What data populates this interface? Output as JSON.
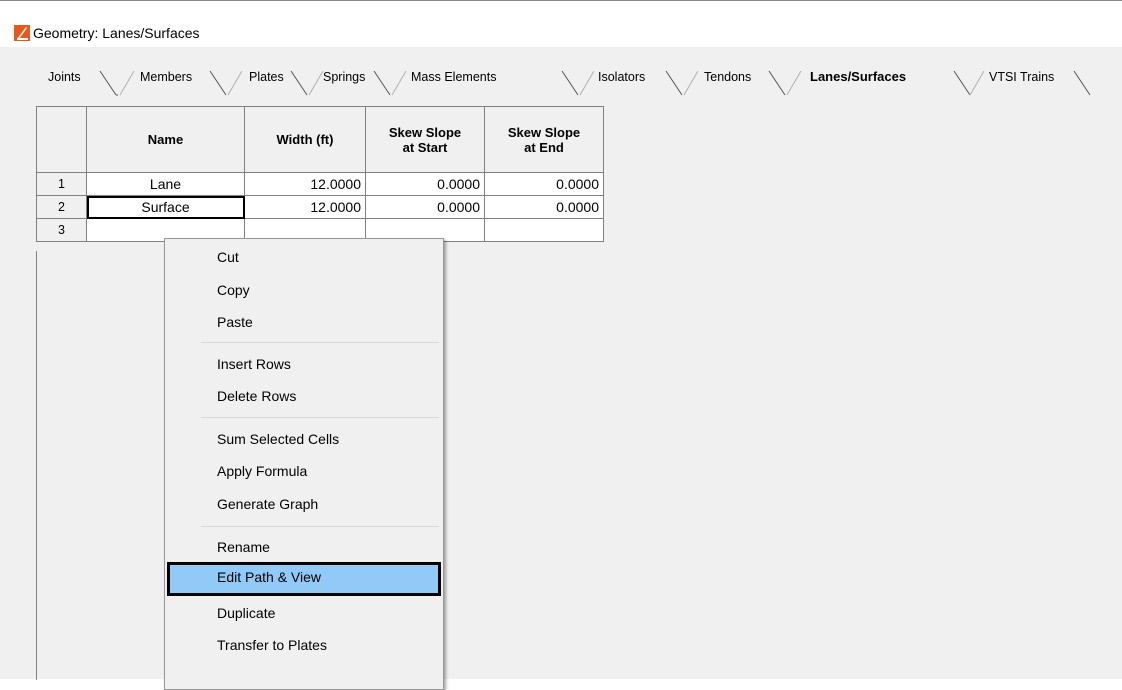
{
  "window": {
    "title": "Geometry: Lanes/Surfaces"
  },
  "tabs": [
    {
      "label": "Joints"
    },
    {
      "label": "Members"
    },
    {
      "label": "Plates"
    },
    {
      "label": "Springs"
    },
    {
      "label": "Mass Elements"
    },
    {
      "label": "Isolators"
    },
    {
      "label": "Tendons"
    },
    {
      "label": "Lanes/Surfaces",
      "active": true
    },
    {
      "label": "VTSI Trains"
    }
  ],
  "grid": {
    "columns": [
      "Name",
      "Width (ft)",
      "Skew Slope at Start",
      "Skew Slope at End"
    ],
    "rows": [
      {
        "num": "1",
        "name": "Lane",
        "width": "12.0000",
        "skew_start": "0.0000",
        "skew_end": "0.0000"
      },
      {
        "num": "2",
        "name": "Surface",
        "width": "12.0000",
        "skew_start": "0.0000",
        "skew_end": "0.0000"
      },
      {
        "num": "3",
        "name": "",
        "width": "",
        "skew_start": "",
        "skew_end": ""
      }
    ]
  },
  "context_menu": {
    "items": [
      {
        "label": "Cut"
      },
      {
        "label": "Copy"
      },
      {
        "label": "Paste"
      },
      {
        "label": "Insert Rows"
      },
      {
        "label": "Delete Rows"
      },
      {
        "label": "Sum Selected Cells"
      },
      {
        "label": "Apply Formula"
      },
      {
        "label": "Generate Graph"
      },
      {
        "label": "Rename"
      },
      {
        "label": "Edit Path & View",
        "highlighted": true
      },
      {
        "label": "Duplicate"
      },
      {
        "label": "Transfer to Plates"
      }
    ]
  },
  "colors": {
    "menu_highlight": "#91c9f7",
    "app_icon": "#e8581c"
  }
}
